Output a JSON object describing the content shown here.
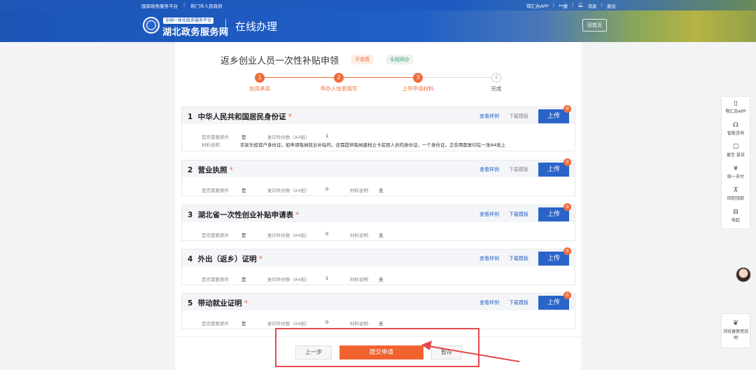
{
  "topbar": {
    "links": [
      "国家政务服务平台",
      "荆门市人民政府"
    ],
    "right": [
      "鄂汇办APP",
      "**捷",
      "消息",
      "退出"
    ]
  },
  "header": {
    "badge": "全国一体化政务服务平台",
    "brand": "湖北政务服务网",
    "service": "在线办理",
    "home_button": "回首页"
  },
  "page": {
    "title": "返乡创业人员一次性补贴申领",
    "tag_fee": "不收费",
    "tag_online": "全程网办"
  },
  "steps": [
    {
      "num": "1",
      "label": "信用承诺"
    },
    {
      "num": "2",
      "label": "申办人信息填写"
    },
    {
      "num": "3",
      "label": "上传申请材料"
    },
    {
      "num": "4",
      "label": "完成"
    }
  ],
  "labels": {
    "need_original": "是否需要原件",
    "copies": "复印件份数（A4纸）",
    "explain": "材料说明",
    "sample": "查看样例",
    "template": "下载模板",
    "upload": "上传"
  },
  "materials": [
    {
      "no": "1",
      "name": "中华人民共和国居民身份证",
      "required": "*",
      "need_original": "是",
      "copies": "1",
      "explain": "农家乐经营户身份证。如申请吸纳就业补贴的，还需提供吸纳建档立卡贫困人员的身份证。一个身份证，正反两面复印在一张A4纸上",
      "count": "0"
    },
    {
      "no": "2",
      "name": "营业执照",
      "required": "*",
      "need_original": "是",
      "copies": "0",
      "explain": "无",
      "count": "0"
    },
    {
      "no": "3",
      "name": "湖北省一次性创业补贴申请表",
      "required": "*",
      "need_original": "是",
      "copies": "0",
      "explain": "无",
      "count": "0"
    },
    {
      "no": "4",
      "name": "外出（返乡）证明",
      "required": "*",
      "need_original": "是",
      "copies": "1",
      "explain": "无",
      "count": "0"
    },
    {
      "no": "5",
      "name": "带动就业证明",
      "required": "*",
      "need_original": "是",
      "copies": "0",
      "explain": "无",
      "count": "0"
    }
  ],
  "buttons": {
    "prev": "上一步",
    "submit": "提交申请",
    "save": "暂存"
  },
  "floatbar": [
    {
      "icon": "phone-icon",
      "glyph": "▯",
      "label": "鄂汇办APP"
    },
    {
      "icon": "headset-icon",
      "glyph": "☊",
      "label": "智能咨询"
    },
    {
      "icon": "message-icon",
      "glyph": "☐",
      "label": "留言 投诉"
    },
    {
      "icon": "yen-icon",
      "glyph": "¥",
      "label": "统一支付"
    },
    {
      "icon": "top-icon",
      "glyph": "⊼",
      "label": "回到顶部"
    },
    {
      "icon": "collapse-icon",
      "glyph": "⊟",
      "label": "收起"
    }
  ],
  "browser_help": "浏览器使用说明",
  "colors": {
    "primary": "#2a64c9",
    "accent": "#f06c3a",
    "highlight_box": "#e5484d"
  }
}
